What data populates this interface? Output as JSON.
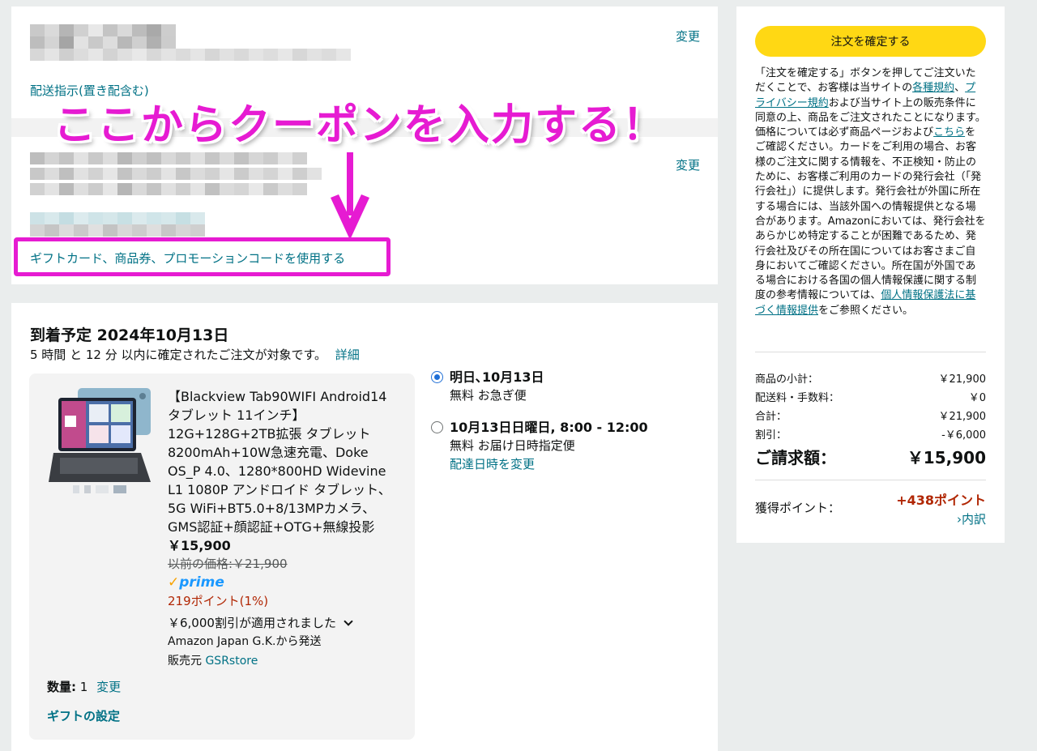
{
  "address": {
    "change_label": "変更",
    "instructions_link": "配送指示(置き配含む)"
  },
  "payment": {
    "change_label": "変更",
    "coupon_link": "ギフトカード、商品券、プロモーションコードを使用する"
  },
  "annotation": {
    "title": "ここからクーポンを入力する！",
    "color": "#e61bd2"
  },
  "delivery": {
    "title": "到着予定 2024年10月13日",
    "subtitle": "5 時間 と 12 分 以内に確定されたご注文が対象です。",
    "details_link": "詳細",
    "item": {
      "name_lines": [
        "【Blackview Tab90WIFI Android14",
        "タブレット 11インチ】",
        "12G+128G+2TB拡張 タブレット",
        "8200mAh+10W急速充電、Doke",
        "OS_P 4.0、1280*800HD Widevine",
        "L1 1080P アンドロイド タブレット、",
        "5G WiFi+BT5.0+8/13MPカメラ、",
        "GMS認証+顔認証+OTG+無線投影"
      ],
      "price": "￥15,900",
      "previous_price": "以前の価格:￥21,900",
      "prime_label": "prime",
      "points": "219ポイント(1%)",
      "discount_note": "￥6,000割引が適用されました",
      "shipped_from": "Amazon Japan G.K.から発送",
      "seller_label": "販売元",
      "seller_name": "GSRstore",
      "qty_label": "数量:",
      "qty_value": "1",
      "qty_change": "変更",
      "gift_settings": "ギフトの設定"
    },
    "options": [
      {
        "title": "明日､10月13日",
        "desc": "無料 お急ぎ便",
        "checked": true
      },
      {
        "title": "10月13日日曜日, 8:00 - 12:00",
        "desc": "無料 お届け日時指定便",
        "change_link": "配達日時を変更",
        "checked": false
      }
    ]
  },
  "summary": {
    "place_order": "注文を確定する",
    "legal": {
      "p1": "「注文を確定する」ボタンを押してご注文いただくことで、お客様は当サイトの",
      "l1": "各種規約",
      "p2": "、",
      "l2": "プライバシー規約",
      "p3": "および当サイト上の販売条件に同意の上、商品をご注文されたことになります。 価格については必ず商品ページおよび",
      "l3": "こちら",
      "p4": "をご確認ください。カードをご利用の場合、お客様のご注文に関する情報を、不正検知・防止のために、お客様ご利用のカードの発行会社（「発行会社」）に提供します。発行会社が外国に所在する場合には、当該外国への情報提供となる場合があります。Amazonにおいては、発行会社をあらかじめ特定することが困難であるため、発行会社及びその所在国についてはお客さまご自身においてご確認ください。所在国が外国である場合における各国の個人情報保護に関する制度の参考情報については、",
      "l4": "個人情報保護法に基づく情報提供",
      "p5": "をご参照ください。"
    },
    "rows": [
      {
        "label": "商品の小計：",
        "value": "￥21,900"
      },
      {
        "label": "配送料・手数料：",
        "value": "￥0"
      },
      {
        "label": "合計：",
        "value": "￥21,900"
      },
      {
        "label": "割引：",
        "value": "-￥6,000"
      }
    ],
    "total_label": "ご請求額：",
    "total_value": "￥15,900",
    "points_label": "獲得ポイント：",
    "points_value": "+438ポイント",
    "breakdown_link": "内訳"
  }
}
